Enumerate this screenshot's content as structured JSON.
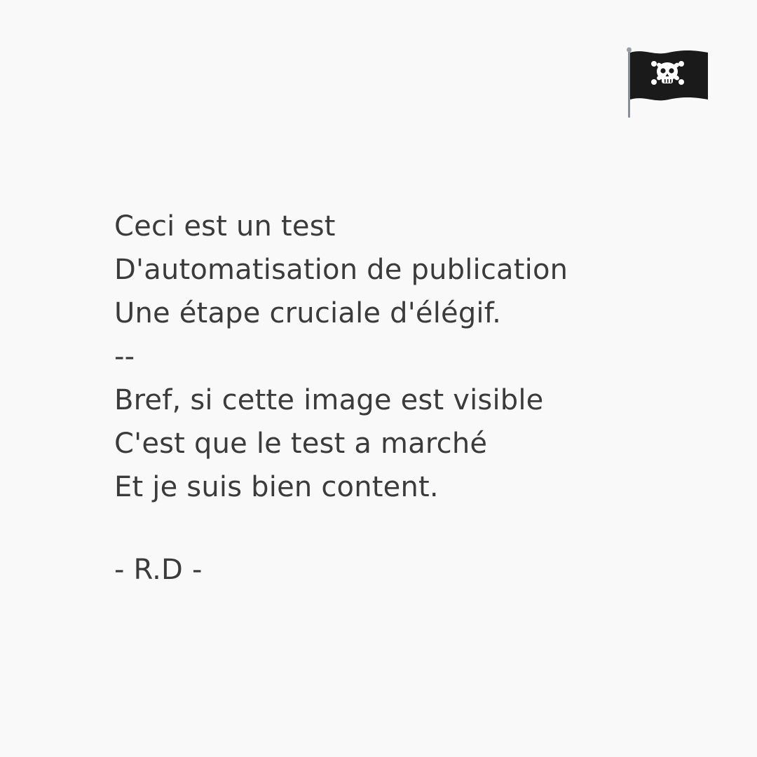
{
  "icon": {
    "name": "pirate-flag-icon",
    "flag_color": "#1a1a1a",
    "symbol_color": "#ffffff",
    "pole_color": "#8a8f96"
  },
  "poem": {
    "lines": [
      "Ceci est un test",
      "D'automatisation de publication",
      "Une étape cruciale d'élégif.",
      "--",
      "Bref, si cette image est visible",
      "C'est que le test a marché",
      "Et je suis bien content."
    ],
    "signature": "- R.D -"
  },
  "colors": {
    "background": "#f9f9f9",
    "text": "#3b3b3b"
  }
}
